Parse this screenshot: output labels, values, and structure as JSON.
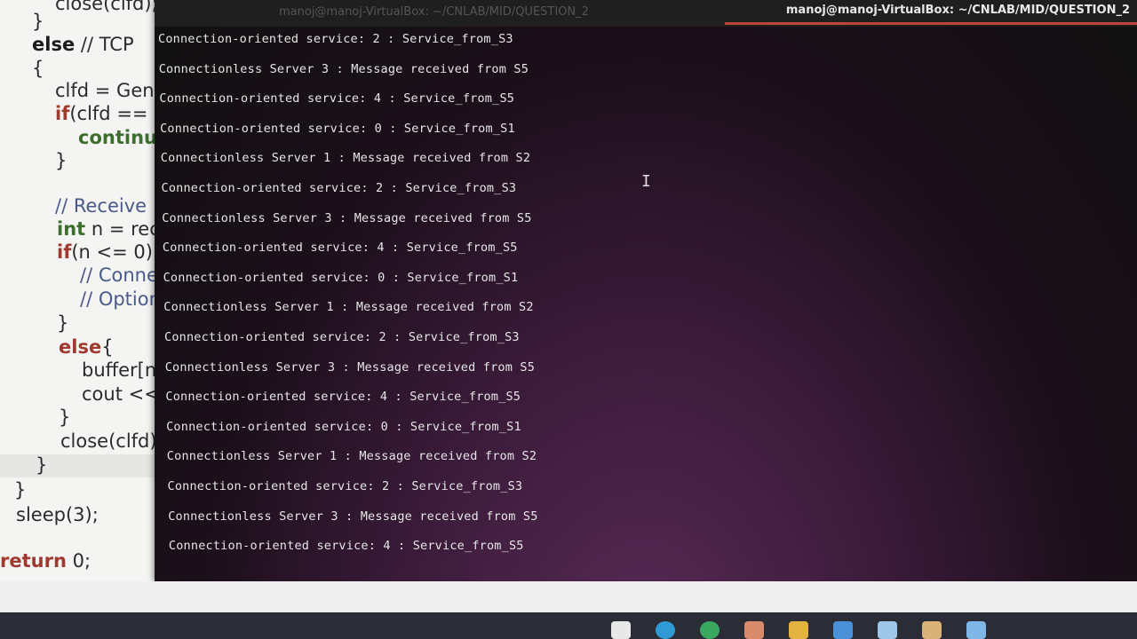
{
  "editor": {
    "lines": [
      {
        "text": "close(clfd);",
        "cls": ""
      },
      {
        "text": "}",
        "cls": ""
      },
      {
        "kw": "else",
        "text": " // TCP",
        "cls": ""
      },
      {
        "text": "{",
        "cls": ""
      },
      {
        "text": "clfd = Gen",
        "cls": ""
      },
      {
        "kw": "if",
        "text": "(clfd ==",
        "cls": ""
      },
      {
        "kw": "continu",
        "text": "",
        "cls": ""
      },
      {
        "text": "}",
        "cls": ""
      },
      {
        "text": "// Receive",
        "cls": "cm"
      },
      {
        "kw": "int",
        "text": " n = rec",
        "cls": ""
      },
      {
        "kw": "if",
        "text": "(n <= 0)",
        "cls": ""
      },
      {
        "text": "// Conne",
        "cls": "cm"
      },
      {
        "text": "// Option",
        "cls": "cm"
      },
      {
        "text": "}",
        "cls": ""
      },
      {
        "kw": "else",
        "text": "{",
        "cls": ""
      },
      {
        "text": "buffer[n",
        "cls": ""
      },
      {
        "text": "cout <<",
        "cls": ""
      },
      {
        "text": "}",
        "cls": ""
      },
      {
        "text": "close(clfd);",
        "cls": ""
      },
      {
        "text": "}",
        "cls": ""
      },
      {
        "text": "}",
        "cls": ""
      },
      {
        "text": "sleep(3);",
        "cls": ""
      },
      {
        "kw": "return",
        "text": " 0;",
        "cls": ""
      }
    ]
  },
  "terminal": {
    "ghost_title": "manoj@manoj-VirtualBox: ~/CNLAB/MID/QUESTION_2",
    "title": "manoj@manoj-VirtualBox: ~/CNLAB/MID/QUESTION_2",
    "lines": [
      "Connection-oriented service: 2 : Service_from_S3",
      "Connectionless Server 3 : Message received from S5",
      "Connection-oriented service: 4 : Service_from_S5",
      "Connection-oriented service: 0 : Service_from_S1",
      "Connectionless Server 1 : Message received from S2",
      "Connection-oriented service: 2 : Service_from_S3",
      "Connectionless Server 3 : Message received from S5",
      "Connection-oriented service: 4 : Service_from_S5",
      "Connection-oriented service: 0 : Service_from_S1",
      "Connectionless Server 1 : Message received from S2",
      "Connection-oriented service: 2 : Service_from_S3",
      "Connectionless Server 3 : Message received from S5",
      "Connection-oriented service: 4 : Service_from_S5",
      "Connection-oriented service: 0 : Service_from_S1",
      "Connectionless Server 1 : Message received from S2",
      "Connection-oriented service: 2 : Service_from_S3",
      "Connectionless Server 3 : Message received from S5",
      "Connection-oriented service: 4 : Service_from_S5"
    ]
  },
  "taskbar": {
    "icons": [
      {
        "name": "files-icon",
        "color": "#e8e8e8"
      },
      {
        "name": "edge-icon",
        "color": "#2f9ad6"
      },
      {
        "name": "chrome-icon",
        "color": "#3aa860"
      },
      {
        "name": "app-icon",
        "color": "#d98a6a"
      },
      {
        "name": "folder-icon",
        "color": "#e3b341"
      },
      {
        "name": "settings-icon",
        "color": "#4a90d9"
      },
      {
        "name": "virtualbox-icon",
        "color": "#9ec6e8"
      },
      {
        "name": "tools-icon",
        "color": "#d9b27a"
      },
      {
        "name": "notepad-icon",
        "color": "#7fb7e6"
      }
    ]
  }
}
